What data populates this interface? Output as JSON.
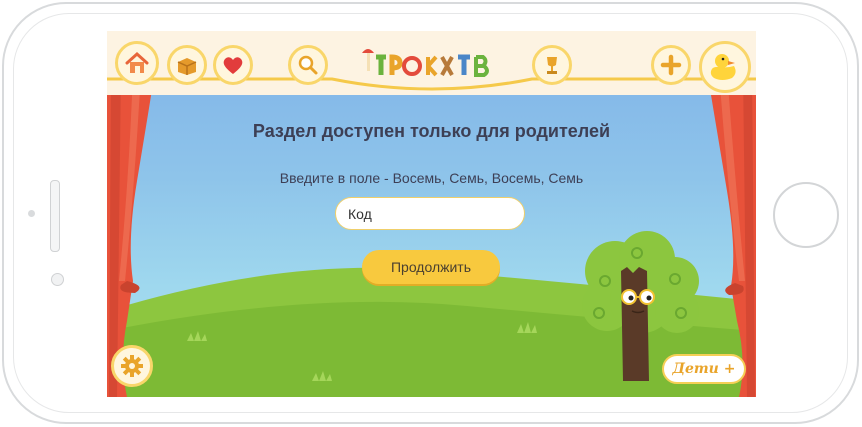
{
  "app": {
    "logo_text": "ТРОКТВ"
  },
  "topbar": {
    "home_icon": "home-icon",
    "collection_icon": "box-icon",
    "favorites_icon": "heart-icon",
    "search_icon": "search-icon",
    "awards_icon": "trophy-icon",
    "add_icon": "plus-icon",
    "profile_icon": "duck-icon"
  },
  "main": {
    "title": "Раздел доступен только для родителей",
    "instruction": "Введите в поле - Восемь, Семь, Восемь, Семь",
    "code_placeholder": "Код",
    "code_value": "",
    "continue_label": "Продолжить"
  },
  "bottom": {
    "settings_icon": "gear-icon",
    "kids_label": "Дети +"
  },
  "colors": {
    "accent": "#f8c93e",
    "title_text": "#3d3f55",
    "sky": "#8ec4ea",
    "grass": "#8dc63f",
    "curtain": "#e8523a"
  }
}
